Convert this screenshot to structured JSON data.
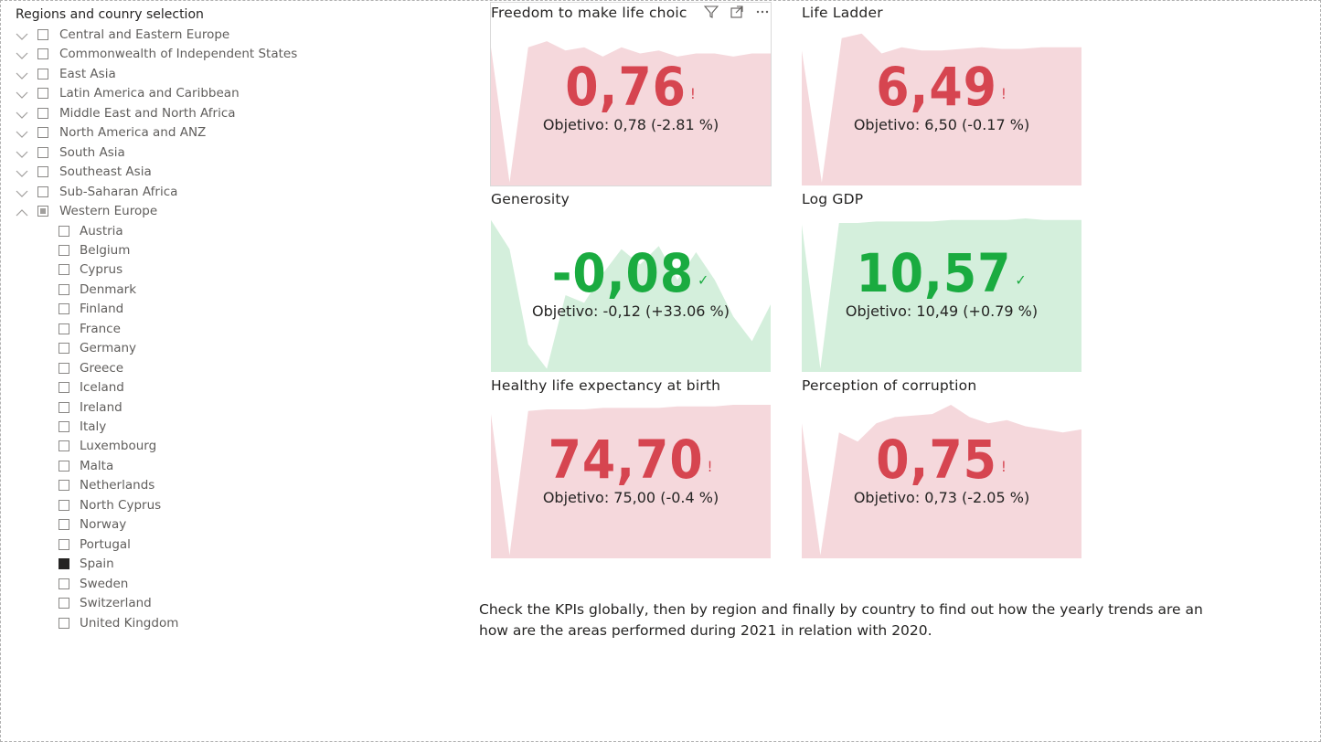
{
  "slicer": {
    "title": "Regions and counry selection",
    "regions": [
      {
        "label": "Central and Eastern Europe",
        "state": "collapsed",
        "checked": "none"
      },
      {
        "label": "Commonwealth of Independent States",
        "state": "collapsed",
        "checked": "none"
      },
      {
        "label": "East Asia",
        "state": "collapsed",
        "checked": "none"
      },
      {
        "label": "Latin America and Caribbean",
        "state": "collapsed",
        "checked": "none"
      },
      {
        "label": "Middle East and North Africa",
        "state": "collapsed",
        "checked": "none"
      },
      {
        "label": "North America and ANZ",
        "state": "collapsed",
        "checked": "none"
      },
      {
        "label": "South Asia",
        "state": "collapsed",
        "checked": "none"
      },
      {
        "label": "Southeast Asia",
        "state": "collapsed",
        "checked": "none"
      },
      {
        "label": "Sub-Saharan Africa",
        "state": "collapsed",
        "checked": "none"
      },
      {
        "label": "Western Europe",
        "state": "expanded",
        "checked": "partial"
      }
    ],
    "countries": [
      {
        "label": "Austria",
        "checked": false
      },
      {
        "label": "Belgium",
        "checked": false
      },
      {
        "label": "Cyprus",
        "checked": false
      },
      {
        "label": "Denmark",
        "checked": false
      },
      {
        "label": "Finland",
        "checked": false
      },
      {
        "label": "France",
        "checked": false
      },
      {
        "label": "Germany",
        "checked": false
      },
      {
        "label": "Greece",
        "checked": false
      },
      {
        "label": "Iceland",
        "checked": false
      },
      {
        "label": "Ireland",
        "checked": false
      },
      {
        "label": "Italy",
        "checked": false
      },
      {
        "label": "Luxembourg",
        "checked": false
      },
      {
        "label": "Malta",
        "checked": false
      },
      {
        "label": "Netherlands",
        "checked": false
      },
      {
        "label": "North Cyprus",
        "checked": false
      },
      {
        "label": "Norway",
        "checked": false
      },
      {
        "label": "Portugal",
        "checked": false
      },
      {
        "label": "Spain",
        "checked": true
      },
      {
        "label": "Sweden",
        "checked": false
      },
      {
        "label": "Switzerland",
        "checked": false
      },
      {
        "label": "United Kingdom",
        "checked": false
      }
    ]
  },
  "kpis": [
    {
      "title": "Freedom to make life choic",
      "value": "0,76",
      "status": "bad",
      "mark": "!",
      "goal": "Objetivo: 0,78 (-2.81 %)",
      "trend": [
        0.9,
        0.02,
        0.9,
        0.94,
        0.88,
        0.9,
        0.84,
        0.9,
        0.86,
        0.88,
        0.84,
        0.86,
        0.86,
        0.84,
        0.86,
        0.86
      ]
    },
    {
      "title": "Life Ladder",
      "value": "6,49",
      "status": "bad",
      "mark": "!",
      "goal": "Objetivo: 6,50 (-0.17 %)",
      "trend": [
        0.88,
        0.02,
        0.96,
        0.99,
        0.86,
        0.9,
        0.88,
        0.88,
        0.89,
        0.9,
        0.89,
        0.89,
        0.9,
        0.9,
        0.9
      ]
    },
    {
      "title": "Generosity",
      "value": "-0,08",
      "status": "good",
      "mark": "✓",
      "goal": "Objetivo: -0,12 (+33.06 %)",
      "trend": [
        0.99,
        0.8,
        0.18,
        0.02,
        0.5,
        0.45,
        0.64,
        0.8,
        0.7,
        0.82,
        0.6,
        0.78,
        0.6,
        0.36,
        0.2,
        0.44
      ]
    },
    {
      "title": "Log GDP",
      "value": "10,57",
      "status": "good",
      "mark": "✓",
      "goal": "Objetivo: 10,49 (+0.79 %)",
      "trend": [
        0.96,
        0.02,
        0.97,
        0.97,
        0.98,
        0.98,
        0.98,
        0.98,
        0.99,
        0.99,
        0.99,
        0.99,
        1.0,
        0.99,
        0.99,
        0.99
      ]
    },
    {
      "title": "Healthy life expectancy at birth",
      "value": "74,70",
      "status": "bad",
      "mark": "!",
      "goal": "Objetivo: 75,00 (-0.4 %)",
      "trend": [
        0.94,
        0.02,
        0.96,
        0.97,
        0.97,
        0.97,
        0.98,
        0.98,
        0.98,
        0.98,
        0.99,
        0.99,
        0.99,
        1.0,
        1.0,
        1.0
      ]
    },
    {
      "title": "Perception of corruption",
      "value": "0,75",
      "status": "bad",
      "mark": "!",
      "goal": "Objetivo: 0,73 (-2.05 %)",
      "trend": [
        0.88,
        0.02,
        0.82,
        0.76,
        0.88,
        0.92,
        0.93,
        0.94,
        1.0,
        0.92,
        0.88,
        0.9,
        0.86,
        0.84,
        0.82,
        0.84
      ]
    }
  ],
  "colors": {
    "bad_bg": "#f5d8dc",
    "bad_fg": "#d64550",
    "good_bg": "#d4efdc",
    "good_fg": "#1aab40"
  },
  "note": "Check the KPIs globally, then by region and finally by country to find out how the yearly trends are an how are the areas performed during 2021 in relation with 2020."
}
